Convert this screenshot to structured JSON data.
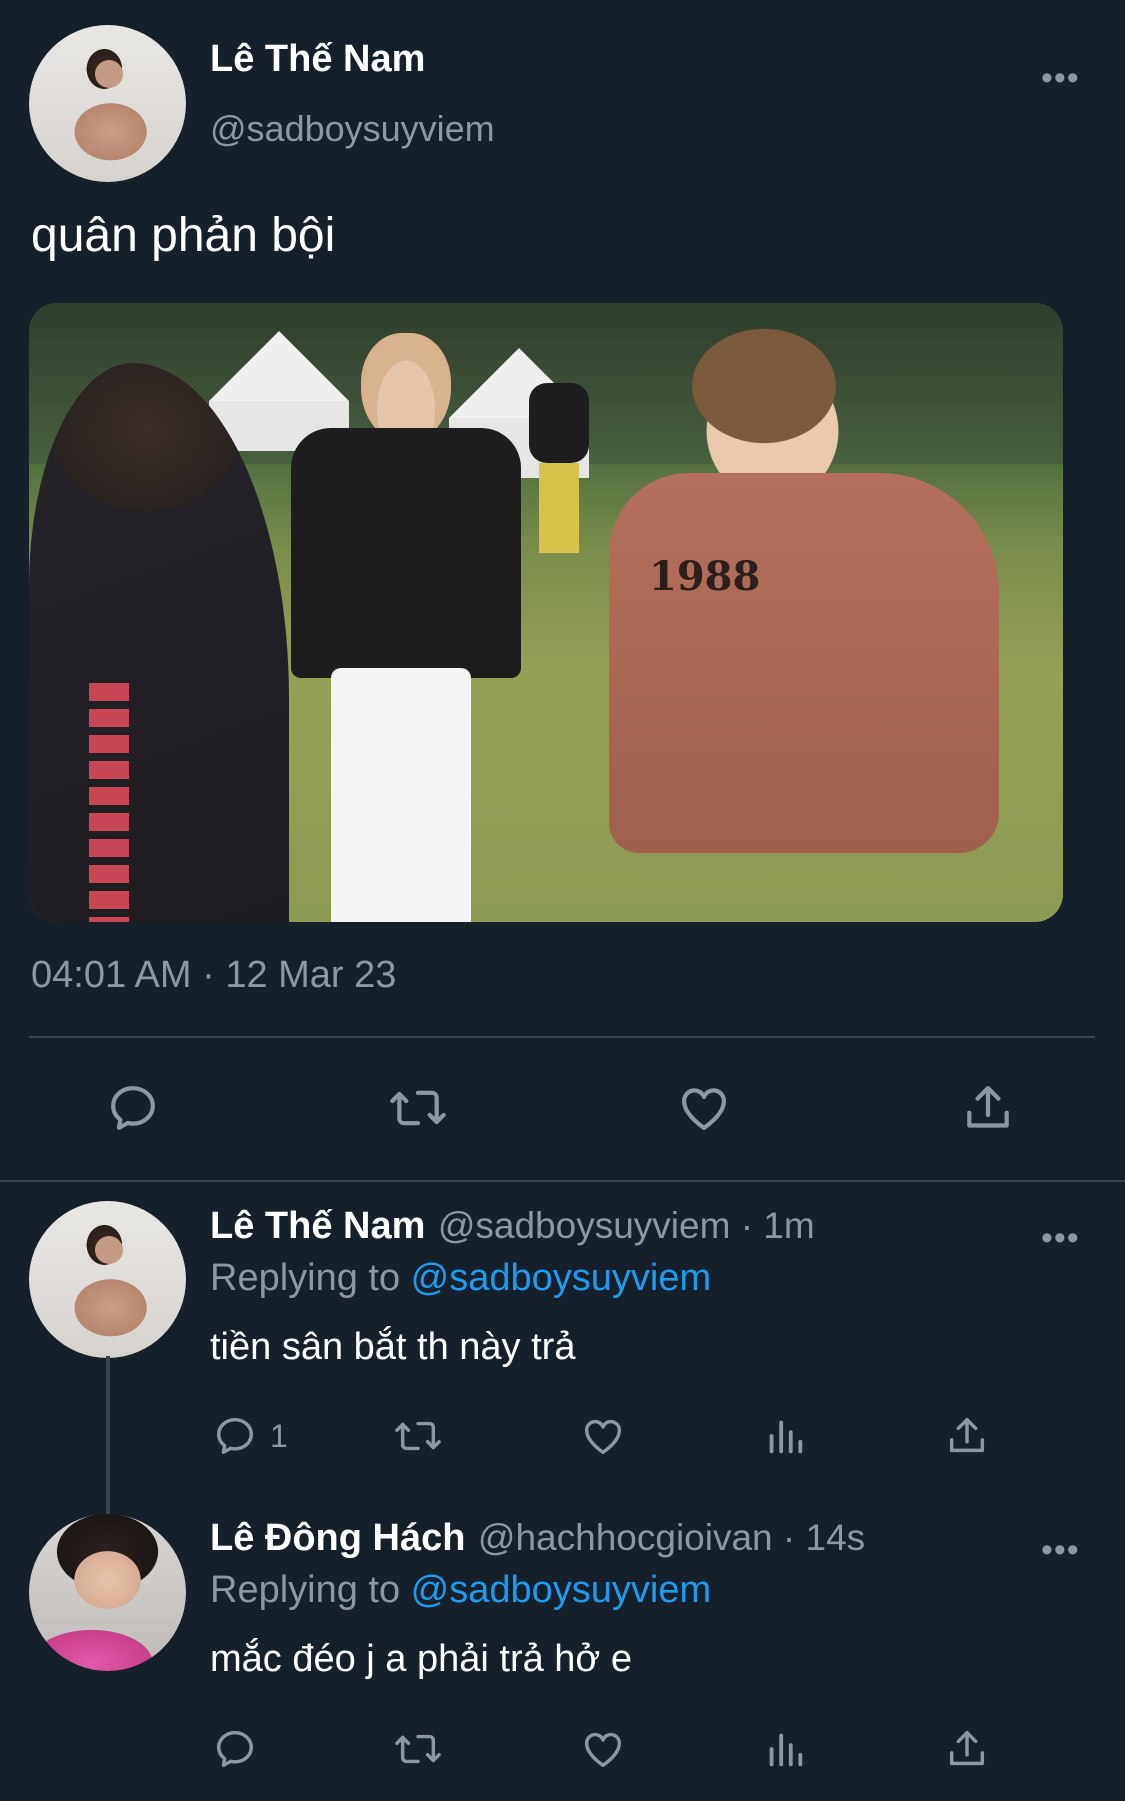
{
  "main_tweet": {
    "author_name": "Lê Thế Nam",
    "author_handle": "@sadboysuyviem",
    "more_label": "•••",
    "text": "quân phản bội",
    "media_print_text": "1988",
    "timestamp": "04:01 AM · 12 Mar 23",
    "actions": [
      {
        "icon": "reply-icon"
      },
      {
        "icon": "retweet-icon"
      },
      {
        "icon": "like-icon"
      },
      {
        "icon": "share-icon"
      }
    ]
  },
  "replies": [
    {
      "author_name": "Lê Thế Nam",
      "meta": "@sadboysuyviem · 1m",
      "replying_prefix": "Replying to ",
      "replying_mention": "@sadboysuyviem",
      "text": "tiền sân bắt th này trả",
      "more_label": "•••",
      "reply_count": "1"
    },
    {
      "author_name": "Lê Đông Hách",
      "meta": "@hachhocgioivan · 14s",
      "replying_prefix": "Replying to ",
      "replying_mention": "@sadboysuyviem",
      "text": "mắc đéo j a phải trả hở e",
      "more_label": "•••"
    }
  ],
  "colors": {
    "background": "#15202b",
    "secondary_text": "#8b98a5",
    "link": "#1d9bf0",
    "divider": "#38444d"
  }
}
